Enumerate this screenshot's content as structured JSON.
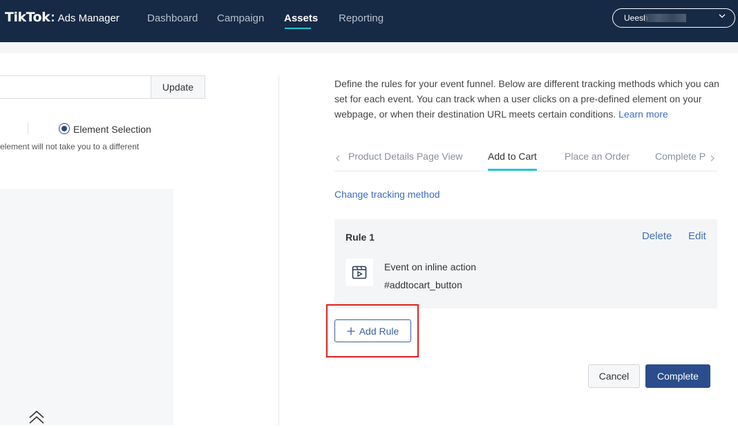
{
  "header": {
    "logo_mark": "TikTok",
    "logo_colon": ":",
    "logo_sub": "Ads Manager",
    "nav": [
      "Dashboard",
      "Campaign",
      "Assets",
      "Reporting"
    ],
    "active_nav": "Assets",
    "account_name": "Ueesh"
  },
  "left_panel": {
    "update_label": "Update",
    "radio_label": "Element Selection",
    "hint": "element will not take you to a different"
  },
  "right_panel": {
    "description": "Define the rules for your event funnel. Below are different tracking methods which you can set for each event. You can track when a user clicks on a pre-defined element on your webpage, or when their destination URL meets certain conditions.",
    "learn_more": "Learn more",
    "tabs": [
      "Product Details Page View",
      "Add to Cart",
      "Place an Order",
      "Complete P"
    ],
    "active_tab": "Add to Cart",
    "change_tracking": "Change tracking method",
    "rule": {
      "title": "Rule 1",
      "delete_label": "Delete",
      "edit_label": "Edit",
      "event_type": "Event on inline action",
      "selector": "#addtocart_button"
    },
    "add_rule_label": "Add Rule",
    "cancel_label": "Cancel",
    "complete_label": "Complete"
  },
  "colors": {
    "nav_bg": "#162a45",
    "accent_teal": "#25c7d3",
    "primary_blue": "#2b4d8c",
    "link_blue": "#3a6cc4",
    "highlight_red": "#e02020"
  }
}
